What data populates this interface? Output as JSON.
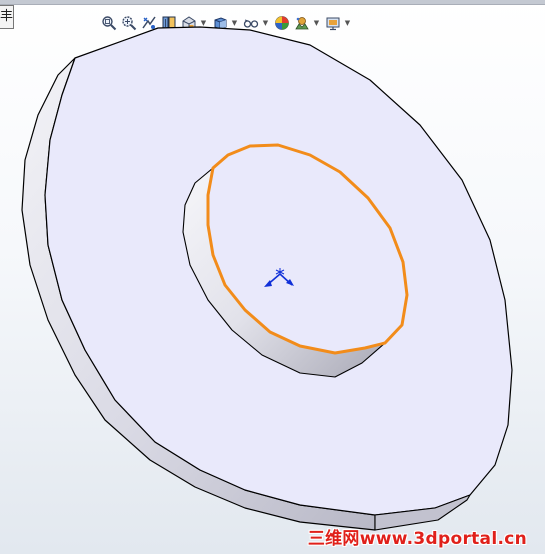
{
  "feature_tab": {
    "label": "丰"
  },
  "toolbar": {
    "tools": [
      {
        "name": "zoom-to-fit-icon",
        "dropdown": false
      },
      {
        "name": "zoom-to-area-icon",
        "dropdown": false
      },
      {
        "name": "previous-view-icon",
        "dropdown": false
      },
      {
        "name": "section-view-icon",
        "dropdown": false
      },
      {
        "name": "view-orientation-icon",
        "dropdown": true
      },
      {
        "name": "display-style-icon",
        "dropdown": true
      },
      {
        "name": "hide-show-items-icon",
        "dropdown": true
      },
      {
        "name": "edit-appearance-icon",
        "dropdown": false
      },
      {
        "name": "apply-scene-icon",
        "dropdown": true
      },
      {
        "name": "view-settings-icon",
        "dropdown": true
      }
    ]
  },
  "model": {
    "part_color": "#e9e9fb",
    "side_color": "#d9d9e4",
    "selection_color": "#f28c1a",
    "triad_color": "#1030d8"
  },
  "watermark": {
    "text": "三维网www.3dportal.cn"
  }
}
